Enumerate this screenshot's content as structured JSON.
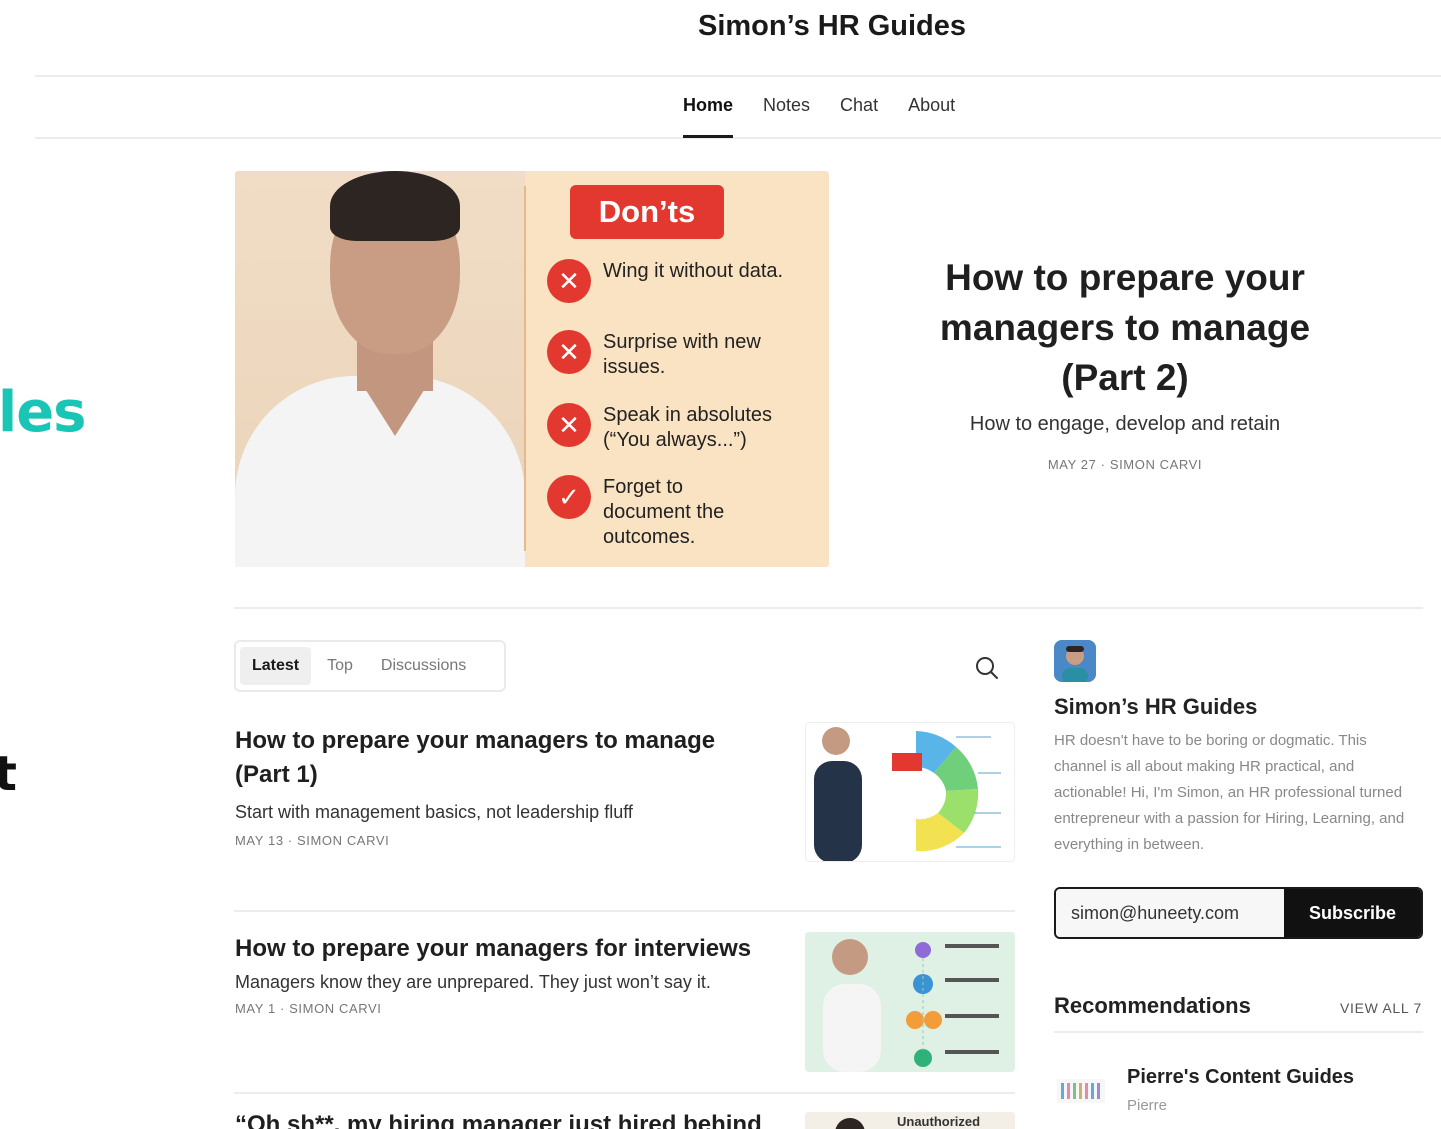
{
  "overlay": {
    "teal_fragment": "les",
    "black_fragment": "t"
  },
  "site": {
    "title": "Simon’s HR Guides"
  },
  "nav": {
    "items": [
      "Home",
      "Notes",
      "Chat",
      "About"
    ]
  },
  "hero": {
    "badge": "Don’ts",
    "rules": [
      {
        "text": "Wing it without data.",
        "icon": "x-icon"
      },
      {
        "text": "Surprise with new issues.",
        "icon": "x-icon"
      },
      {
        "text": "Speak in absolutes (“You always...”)",
        "icon": "x-icon"
      },
      {
        "text": "Forget to document the outcomes.",
        "icon": "check-icon"
      }
    ],
    "title": "How to prepare your managers to manage (Part 2)",
    "subtitle": "How to engage, develop and retain",
    "meta": "MAY 27 · SIMON CARVI"
  },
  "tabs": [
    "Latest",
    "Top",
    "Discussions"
  ],
  "posts": [
    {
      "title": "How to prepare your managers to manage (Part 1)",
      "subtitle": "Start with management basics, not leadership fluff",
      "meta": "MAY 13 · SIMON CARVI"
    },
    {
      "title": "How to prepare your managers for interviews",
      "subtitle": "Managers know they are unprepared. They just won’t say it.",
      "meta": "MAY 1 · SIMON CARVI"
    },
    {
      "title": "“Oh sh**, my hiring manager just hired behind",
      "thumb_label": "Unauthorized"
    }
  ],
  "sidebar": {
    "name": "Simon’s HR Guides",
    "description": "HR doesn't have to be boring or dogmatic. This channel is all about making HR practical, and actionable! Hi, I'm Simon, an HR professional turned entrepreneur with a passion for Hiring, Learning, and everything in between.",
    "email_value": "simon@huneety.com",
    "subscribe_label": "Subscribe",
    "recommendations_label": "Recommendations",
    "view_all_label": "VIEW ALL 7",
    "recommendation": {
      "name": "Pierre's Content Guides",
      "author": "Pierre"
    }
  },
  "colors": {
    "accent_teal": "#19c6b5",
    "donts_red": "#e3382f",
    "hero_bg": "#fae3c2"
  }
}
